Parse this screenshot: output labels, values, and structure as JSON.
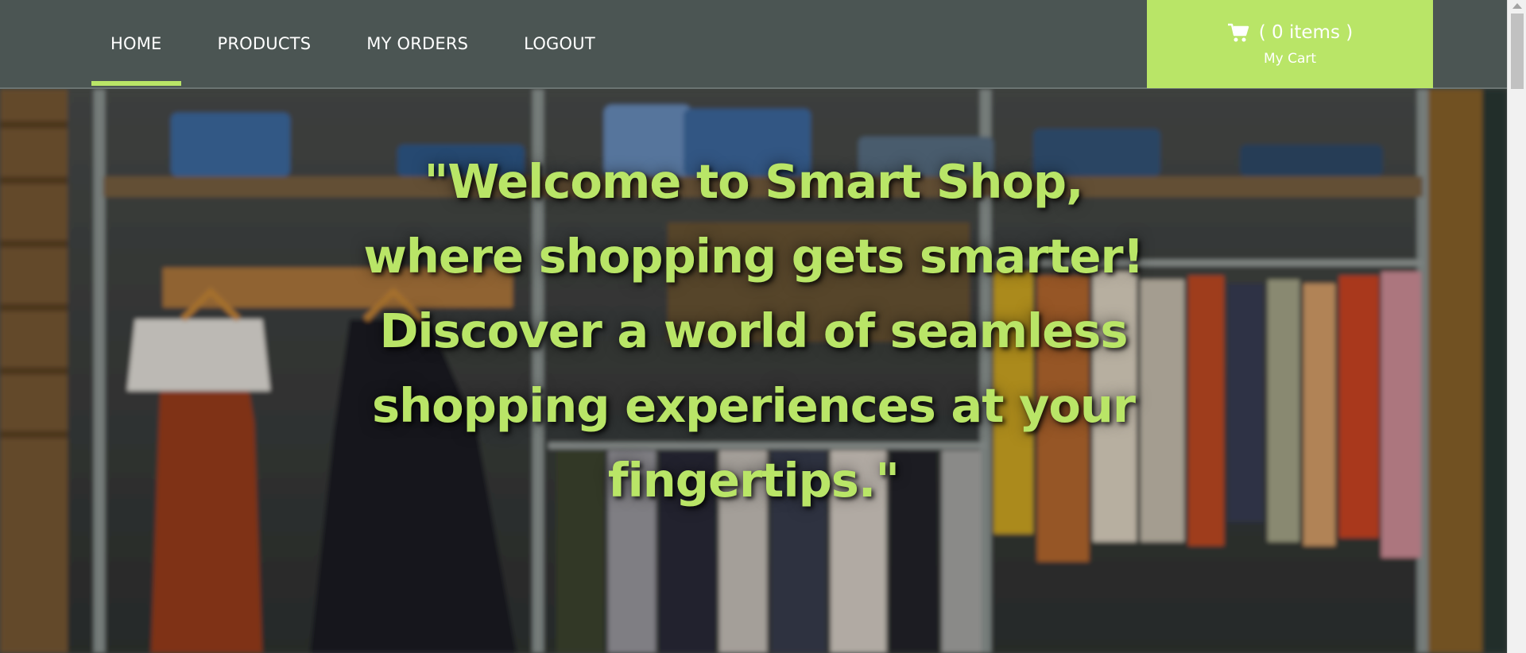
{
  "nav": {
    "items": [
      {
        "label": "HOME",
        "active": true
      },
      {
        "label": "PRODUCTS",
        "active": false
      },
      {
        "label": "MY ORDERS",
        "active": false
      },
      {
        "label": "LOGOUT",
        "active": false
      }
    ]
  },
  "cart": {
    "count_text": "( 0 items )",
    "label": "My Cart",
    "icon": "shopping-cart-icon"
  },
  "hero": {
    "lines": [
      "\"Welcome to Smart Shop,",
      "where shopping gets smarter!",
      "Discover a world of seamless",
      "shopping experiences at your",
      "fingertips.\""
    ]
  },
  "colors": {
    "navbar": "#4b5553",
    "accent": "#b9e567",
    "nav_text": "#ffffff"
  }
}
